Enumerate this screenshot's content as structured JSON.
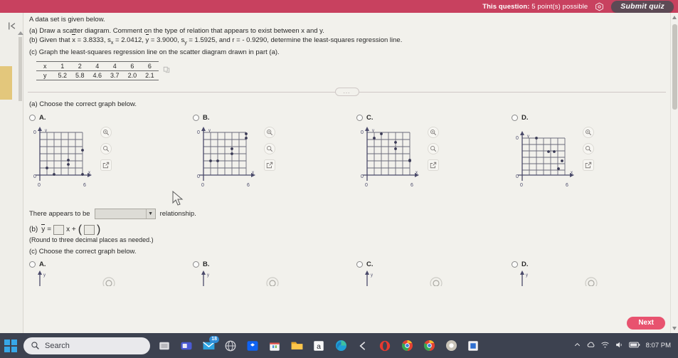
{
  "topbar": {
    "question_points": "This question: 5 point(s) possible",
    "question_label": "This question:",
    "points_text": " 5 point(s) possible",
    "help_icon": "hexagon-help-icon",
    "submit_label": "Submit quiz",
    "bg_color": "#c8415f",
    "submit_bg": "#5d4a55"
  },
  "rail": {
    "collapse_icon": "collapse-left-icon",
    "collapse_glyph": "|←"
  },
  "question": {
    "intro": "A data set is given below.",
    "part_a_prompt": "(a) Draw a scatter diagram. Comment on the type of relation that appears to exist between x and y.",
    "part_b_prefix": "(b) Given that ",
    "part_b_xbar": "x",
    "part_b_xbar_val": " = 3.8333, ",
    "part_b_sx": "s",
    "part_b_sx_sub": "x",
    "part_b_sx_val": " = 2.0412, ",
    "part_b_ybar": "y",
    "part_b_ybar_val": " = 3.9000, ",
    "part_b_sy": "s",
    "part_b_sy_sub": "y",
    "part_b_sy_val": " = 1.5925, and r = ",
    "part_b_r": "- 0.9290, determine the least-squares regression line.",
    "part_c_prompt": "(c) Graph the least-squares regression line on the scatter diagram drawn in part (a)."
  },
  "dataset": {
    "row_labels": [
      "x",
      "y"
    ],
    "x_values": [
      "1",
      "2",
      "4",
      "4",
      "6",
      "6"
    ],
    "y_values": [
      "5.2",
      "5.8",
      "4.6",
      "3.7",
      "2.0",
      "2.1"
    ],
    "copy_icon": "copy-icon"
  },
  "divider": {
    "ellipsis": "...",
    "icon": "more-options-icon"
  },
  "part_a": {
    "prompt": "(a) Choose the correct graph below.",
    "options": [
      {
        "letter": "A.",
        "selected": false
      },
      {
        "letter": "B.",
        "selected": false
      },
      {
        "letter": "C.",
        "selected": false
      },
      {
        "letter": "D.",
        "selected": false
      }
    ],
    "tool_icons": [
      "zoom-in-icon",
      "zoom-icon",
      "pop-out-icon"
    ]
  },
  "relation": {
    "prefix": "There appears to be",
    "dropdown_value": "",
    "dropdown_placeholder": "",
    "suffix": "relationship.",
    "arrow_icon": "chevron-down-icon"
  },
  "part_b": {
    "label": "(b)",
    "y_hat": "y",
    "equals": "=",
    "x_term": "x +",
    "slope_value": "",
    "intercept_value": "",
    "note": "(Round to three decimal places as needed.)"
  },
  "part_c": {
    "prompt": "(c) Choose the correct graph below.",
    "options": [
      {
        "letter": "A.",
        "selected": false
      },
      {
        "letter": "B.",
        "selected": false
      },
      {
        "letter": "C.",
        "selected": false
      },
      {
        "letter": "D.",
        "selected": false
      }
    ]
  },
  "footer": {
    "next_label": "Next",
    "next_color": "#e8536f"
  },
  "graph_axes": {
    "origin_label": "0",
    "max_label": "6",
    "x_axis_label": "x",
    "y_axis_label": "y",
    "grid_min": 0,
    "grid_max": 6
  },
  "chart_data": [
    {
      "type": "scatter",
      "id": "option-a",
      "title": "A.",
      "xlabel": "x",
      "ylabel": "y",
      "xlim": [
        0,
        6
      ],
      "ylim": [
        0,
        6
      ],
      "grid": true,
      "points": [
        [
          1,
          1.0
        ],
        [
          2,
          0.1
        ],
        [
          4,
          2.1
        ],
        [
          4,
          1.6
        ],
        [
          6,
          3.5
        ],
        [
          6,
          0.05
        ]
      ]
    },
    {
      "type": "scatter",
      "id": "option-b",
      "title": "B.",
      "xlabel": "x",
      "ylabel": "y",
      "xlim": [
        0,
        6
      ],
      "ylim": [
        0,
        6
      ],
      "grid": true,
      "points": [
        [
          1,
          2.0
        ],
        [
          2,
          2.0
        ],
        [
          4,
          3.7
        ],
        [
          4,
          3.0
        ],
        [
          6,
          5.2
        ],
        [
          6,
          4.6
        ]
      ]
    },
    {
      "type": "scatter",
      "id": "option-c",
      "title": "C.",
      "xlabel": "x",
      "ylabel": "y",
      "xlim": [
        0,
        6
      ],
      "ylim": [
        0,
        6
      ],
      "grid": true,
      "points": [
        [
          1,
          5.2
        ],
        [
          2,
          5.8
        ],
        [
          4,
          4.6
        ],
        [
          4,
          3.7
        ],
        [
          6,
          2.0
        ],
        [
          6,
          2.1
        ]
      ]
    },
    {
      "type": "scatter",
      "id": "option-d",
      "title": "D.",
      "xlabel": "x",
      "ylabel": "y",
      "xlim": [
        0,
        6
      ],
      "ylim": [
        0,
        6
      ],
      "grid": true,
      "points": [
        [
          2,
          5.9
        ],
        [
          3.6,
          4.2
        ],
        [
          4.4,
          4.2
        ],
        [
          5.6,
          2.4
        ],
        [
          5.0,
          1.2
        ]
      ]
    }
  ],
  "taskbar": {
    "start_icon": "windows-start-icon",
    "search_placeholder": "Search",
    "search_icon": "search-icon",
    "items": [
      {
        "name": "task-view-icon",
        "badge": ""
      },
      {
        "name": "widgets-icon",
        "badge": ""
      },
      {
        "name": "mail-icon",
        "badge": "18"
      },
      {
        "name": "edge-globe-icon",
        "badge": ""
      },
      {
        "name": "dropbox-icon",
        "badge": ""
      },
      {
        "name": "store-icon",
        "badge": ""
      },
      {
        "name": "file-explorer-icon",
        "badge": ""
      },
      {
        "name": "amazon-icon",
        "badge": ""
      },
      {
        "name": "edge-browser-icon",
        "badge": ""
      },
      {
        "name": "back-arrow-icon",
        "badge": ""
      },
      {
        "name": "opera-icon",
        "badge": ""
      },
      {
        "name": "chrome-icon",
        "badge": ""
      },
      {
        "name": "chrome-icon-2",
        "badge": ""
      },
      {
        "name": "chrome-icon-3",
        "badge": ""
      },
      {
        "name": "calculator-icon",
        "badge": ""
      }
    ],
    "tray_icons": [
      "up-chevron-icon",
      "onedrive-icon",
      "wifi-icon",
      "volume-icon",
      "battery-icon"
    ],
    "clock": "8:07 PM"
  }
}
